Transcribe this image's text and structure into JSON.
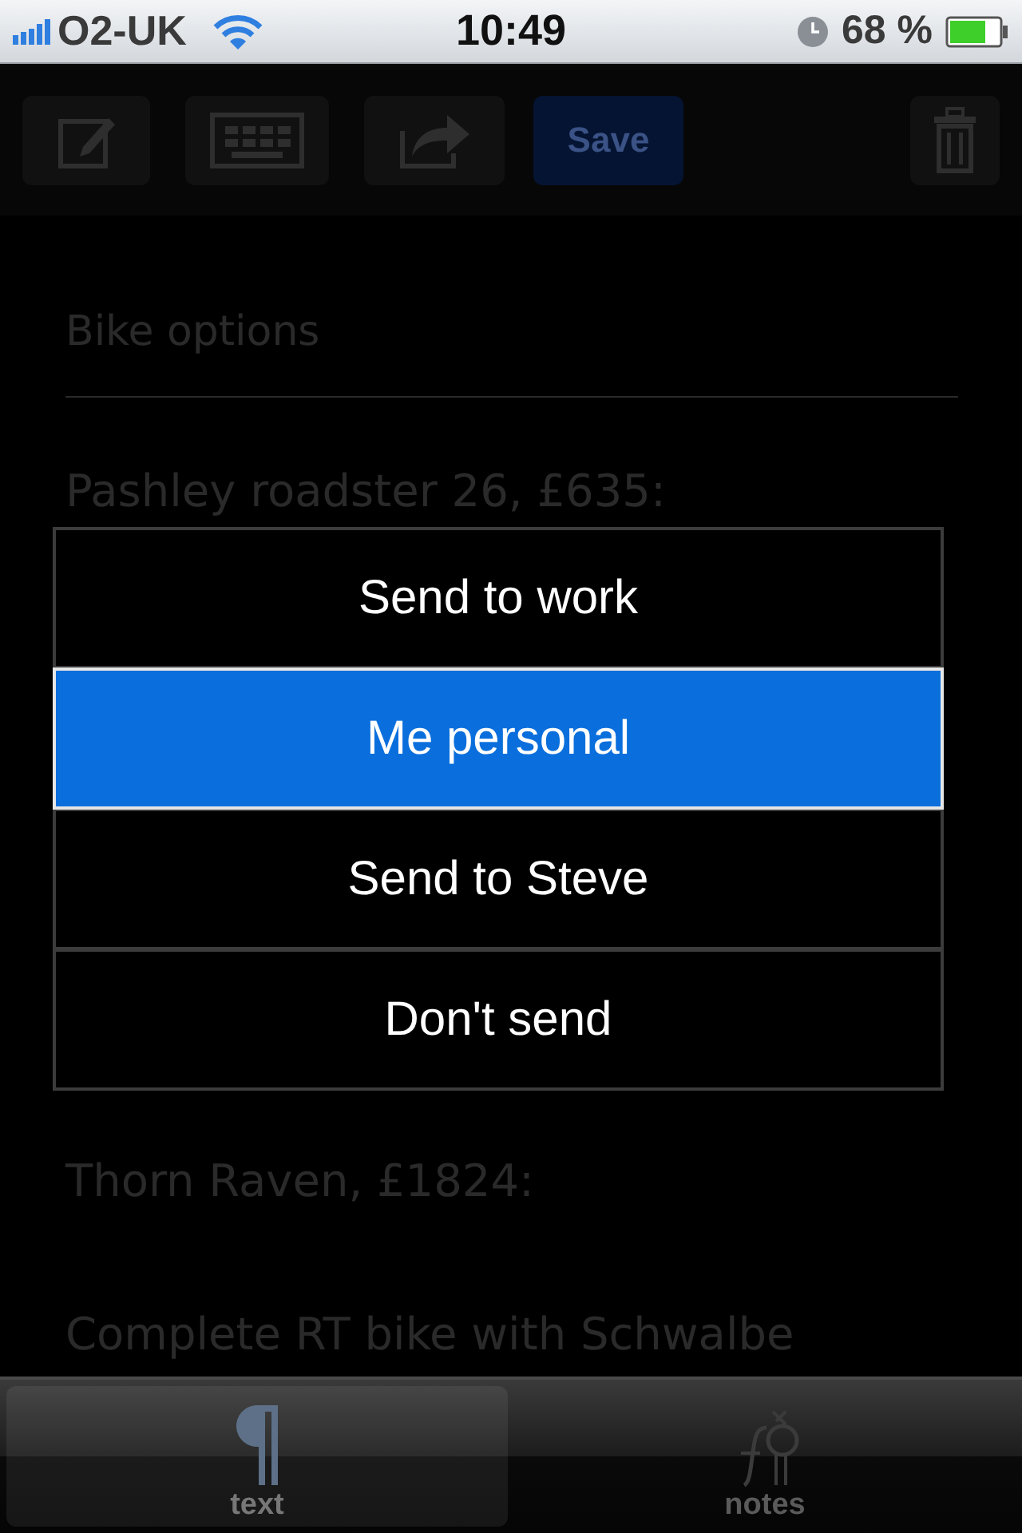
{
  "status_bar": {
    "carrier": "O2-UK",
    "time": "10:49",
    "battery": "68 %"
  },
  "toolbar": [
    {
      "kind": "compose"
    },
    {
      "kind": "keyboard"
    },
    {
      "kind": "share"
    },
    {
      "kind": "text",
      "label": "Save"
    },
    {
      "kind": "trash"
    }
  ],
  "note": {
    "title": "Bike options",
    "lines": [
      {
        "kind": "text",
        "text": "Pashley roadster 26, £635:"
      },
      {
        "kind": "blank"
      },
      {
        "kind": "covered"
      },
      {
        "kind": "covered"
      },
      {
        "kind": "covered"
      },
      {
        "kind": "covered"
      },
      {
        "kind": "covered"
      },
      {
        "kind": "covered"
      },
      {
        "kind": "blank"
      },
      {
        "kind": "text",
        "text": "Thorn Raven, £1824:"
      },
      {
        "kind": "blank"
      },
      {
        "kind": "text",
        "text": "Complete RT bike with Schwalbe"
      }
    ]
  },
  "menu": [
    {
      "label": "Send to work",
      "selected": false
    },
    {
      "label": "Me personal",
      "selected": true
    },
    {
      "label": "Send to Steve",
      "selected": false
    },
    {
      "label": "Don't send",
      "selected": false
    }
  ],
  "tabs": [
    {
      "label": "text",
      "kind": "pilcrow",
      "selected": true
    },
    {
      "label": "notes",
      "kind": "notes",
      "selected": false
    }
  ]
}
